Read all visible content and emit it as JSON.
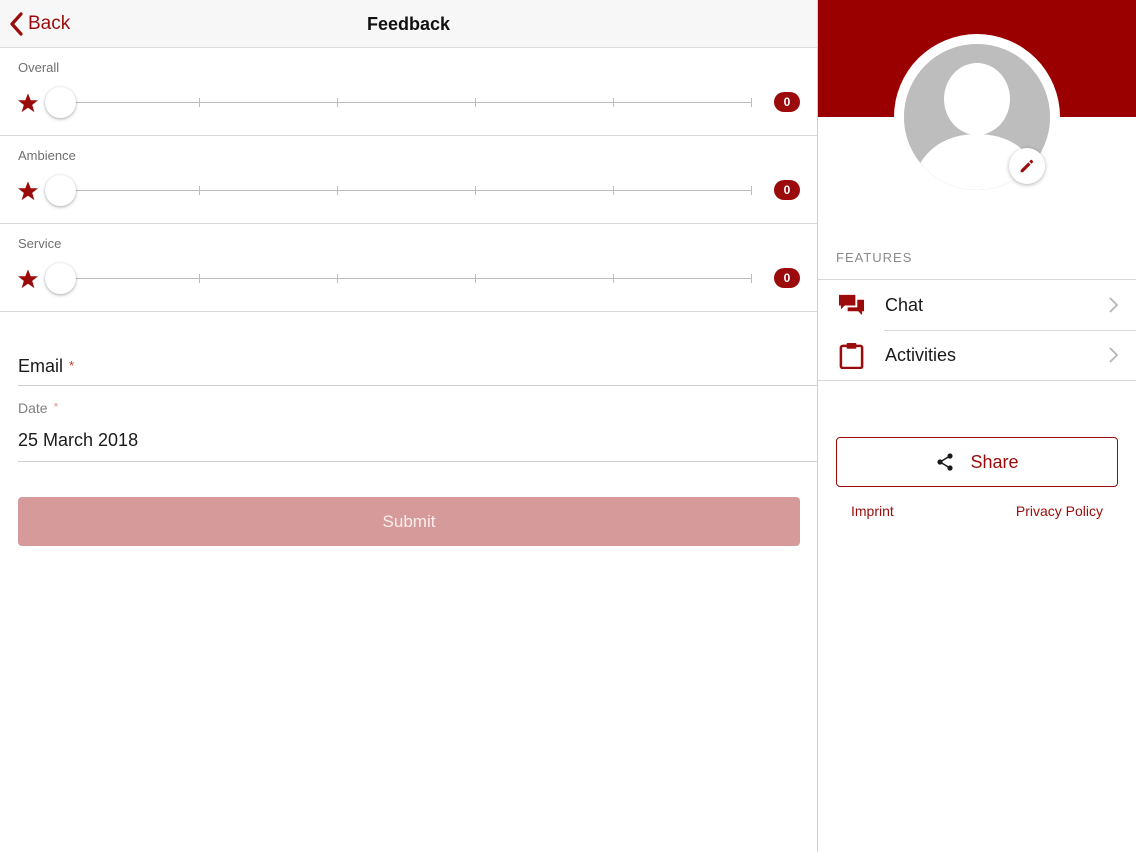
{
  "navbar": {
    "back_label": "Back",
    "title": "Feedback"
  },
  "ratings": [
    {
      "label": "Overall",
      "value": "0"
    },
    {
      "label": "Ambience",
      "value": "0"
    },
    {
      "label": "Service",
      "value": "0"
    }
  ],
  "form": {
    "email_label": "Email",
    "date_label": "Date",
    "required_marker": "*",
    "date_value": "25 March 2018",
    "submit_label": "Submit"
  },
  "sidebar": {
    "features_heading": "FEATURES",
    "features": [
      {
        "label": "Chat",
        "icon": "chat-icon"
      },
      {
        "label": "Activities",
        "icon": "clipboard-icon"
      }
    ],
    "share_label": "Share",
    "imprint_label": "Imprint",
    "privacy_label": "Privacy Policy"
  },
  "colors": {
    "accent": "#9b0b0b",
    "header": "#9b0000",
    "submit_disabled": "#d69a9a"
  }
}
